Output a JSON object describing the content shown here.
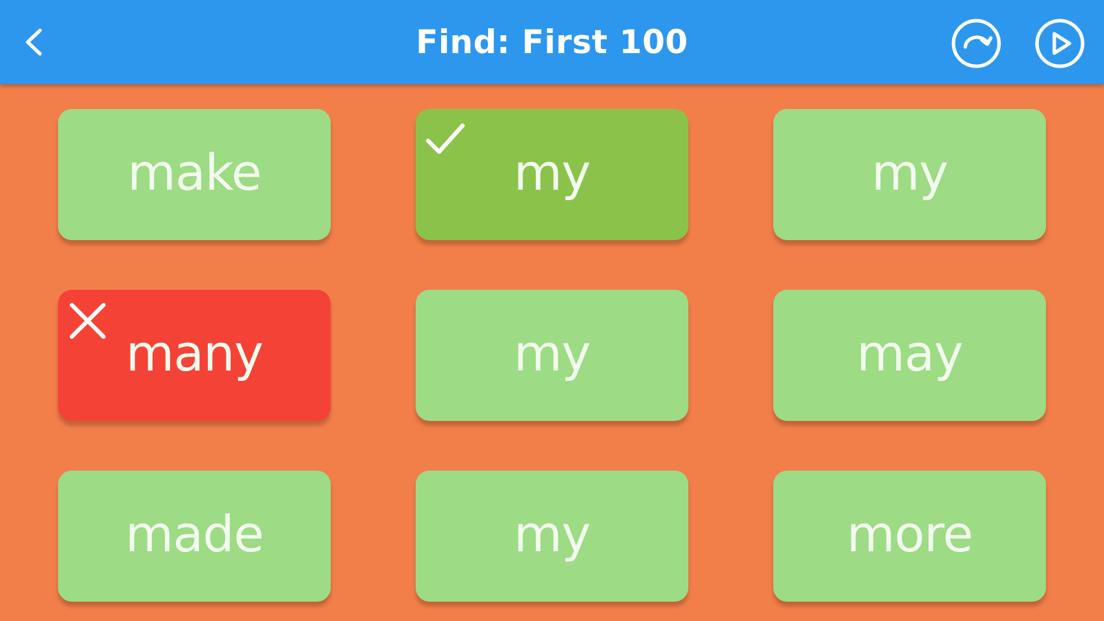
{
  "header": {
    "title": "Find: First 100",
    "back_icon": "chevron-left-icon",
    "refresh_icon": "refresh-circle-icon",
    "play_icon": "play-circle-icon"
  },
  "colors": {
    "header_bg": "#2d97ee",
    "background": "#f27f4a",
    "tile_default": "#9ddb84",
    "tile_correct": "#8bc34a",
    "tile_wrong": "#f44336",
    "text": "#ffffff"
  },
  "tiles": [
    {
      "word": "make",
      "state": "default"
    },
    {
      "word": "my",
      "state": "correct"
    },
    {
      "word": "my",
      "state": "default"
    },
    {
      "word": "many",
      "state": "wrong"
    },
    {
      "word": "my",
      "state": "default"
    },
    {
      "word": "may",
      "state": "default"
    },
    {
      "word": "made",
      "state": "default"
    },
    {
      "word": "my",
      "state": "default"
    },
    {
      "word": "more",
      "state": "default"
    }
  ]
}
